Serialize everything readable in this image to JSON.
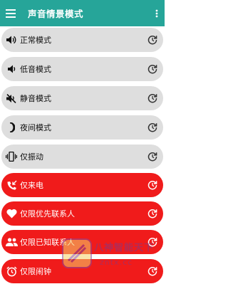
{
  "header": {
    "title": "声音情景模式",
    "bg_color": "#26a599"
  },
  "modes": [
    {
      "label": "正常模式",
      "icon": "volume-up-icon",
      "style": "gray"
    },
    {
      "label": "低音模式",
      "icon": "volume-down-icon",
      "style": "gray"
    },
    {
      "label": "静音模式",
      "icon": "volume-off-icon",
      "style": "gray"
    },
    {
      "label": "夜间模式",
      "icon": "moon-icon",
      "style": "gray"
    },
    {
      "label": "仅振动",
      "icon": "vibrate-icon",
      "style": "gray"
    },
    {
      "label": "仅来电",
      "icon": "phone-incoming-icon",
      "style": "red"
    },
    {
      "label": "仅限优先联系人",
      "icon": "heart-icon",
      "style": "red"
    },
    {
      "label": "仅限已知联系人",
      "icon": "people-icon",
      "style": "red"
    },
    {
      "label": "仅限闹钟",
      "icon": "alarm-icon",
      "style": "red"
    }
  ],
  "colors": {
    "gray_item": "#dedede",
    "red_item": "#f01b1b"
  },
  "watermark": {
    "line1": "八神智能天下",
    "line2": "zntx.cc"
  }
}
